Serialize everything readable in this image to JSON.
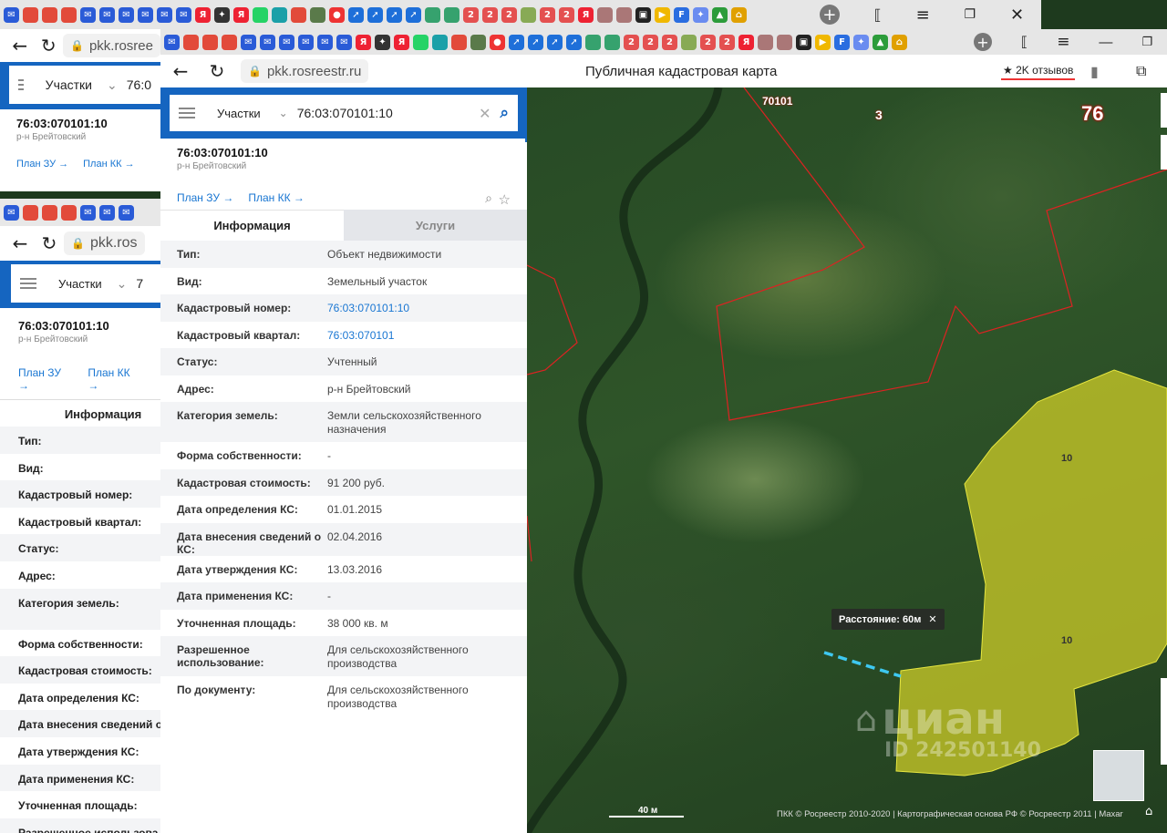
{
  "browser": {
    "site_url": "pkk.rosreestr.ru",
    "site_url_short": "pkk.rosree",
    "site_url_shorter": "pkk.ros",
    "page_title": "Публичная кадастровая карта",
    "reviews": "★ 2K отзывов"
  },
  "search": {
    "type_label": "Участки",
    "query": "76:03:070101:10",
    "query_short": "76:0",
    "query_shorter": "7"
  },
  "object": {
    "number": "76:03:070101:10",
    "region": "р-н Брейтовский",
    "plan_zu": "План ЗУ →",
    "plan_kk": "План КК →"
  },
  "tabs": {
    "info": "Информация",
    "services": "Услуги"
  },
  "info_rows": [
    {
      "key": "Тип:",
      "value": "Объект недвижимости",
      "link": false
    },
    {
      "key": "Вид:",
      "value": "Земельный участок",
      "link": false
    },
    {
      "key": "Кадастровый номер:",
      "value": "76:03:070101:10",
      "link": true
    },
    {
      "key": "Кадастровый квартал:",
      "value": "76:03:070101",
      "link": true
    },
    {
      "key": "Статус:",
      "value": "Учтенный",
      "link": false
    },
    {
      "key": "Адрес:",
      "value": "р-н Брейтовский",
      "link": false
    },
    {
      "key": "Категория земель:",
      "value": "Земли сельскохозяйственного назначения",
      "link": false
    },
    {
      "key": "Форма собственности:",
      "value": "-",
      "link": false
    },
    {
      "key": "Кадастровая стоимость:",
      "value": "91 200 руб.",
      "link": false
    },
    {
      "key": "Дата определения КС:",
      "value": "01.01.2015",
      "link": false
    },
    {
      "key": "Дата внесения сведений о КС:",
      "value": "02.04.2016",
      "link": false
    },
    {
      "key": "Дата утверждения КС:",
      "value": "13.03.2016",
      "link": false
    },
    {
      "key": "Дата применения КС:",
      "value": "-",
      "link": false
    },
    {
      "key": "Уточненная площадь:",
      "value": "38 000 кв. м",
      "link": false
    },
    {
      "key": "Разрешенное использование:",
      "value": "Для сельскохозяйственного производства",
      "link": false
    },
    {
      "key": "По документу:",
      "value": "Для сельскохозяйственного производства",
      "link": false
    }
  ],
  "bg_rows_keys": [
    "Тип:",
    "Вид:",
    "Кадастровый номер:",
    "Кадастровый квартал:",
    "Статус:",
    "Адрес:",
    "Категория земель:",
    "Форма собственности:",
    "Кадастровая стоимость:",
    "Дата определения КС:",
    "Дата внесения сведений о",
    "Дата утверждения КС:",
    "Дата применения КС:",
    "Уточненная площадь:",
    "Разрешенное использова"
  ],
  "map": {
    "label_quarter": "70101",
    "label_3": "3",
    "label_76": "76",
    "parcel_label_a": "10",
    "parcel_label_b": "10",
    "distance_tooltip": "Расстояние: 60м",
    "scale_label": "40 м",
    "copyright": "ПКК © Росреестр 2010-2020 | Картографическая основа РФ © Росреестр 2011 | Maxar",
    "watermark": "циан",
    "watermark_id": "ID 242501140"
  },
  "colors": {
    "brand_blue": "#1565c0",
    "link_blue": "#1976d2",
    "parcel_fill": "#c8c828",
    "boundary_red": "#d22",
    "distance_line": "#3ec8f0"
  },
  "tab_icons": [
    "mail-icon",
    "chrome-icon",
    "yandex-icon",
    "chrome-icon",
    "mail-icon",
    "mail-icon",
    "mail-icon",
    "mail-icon",
    "mail-icon",
    "mail-icon",
    "yandex-y-icon",
    "sparkle-icon",
    "ya-icon",
    "whatsapp-icon",
    "shield-icon",
    "chrome-icon",
    "game-icon",
    "pin-icon",
    "arrow-icon",
    "arrow-icon",
    "arrow-icon",
    "arrow-icon",
    "pkk-icon",
    "pkk-icon",
    "avito-icon",
    "avito-icon",
    "avito-icon",
    "dots-icon",
    "avito-icon",
    "avito-icon",
    "ya-icon",
    "photo-icon",
    "photo-icon",
    "image-icon",
    "play-icon",
    "f-icon",
    "star4-icon",
    "triangle-icon",
    "home-icon"
  ]
}
